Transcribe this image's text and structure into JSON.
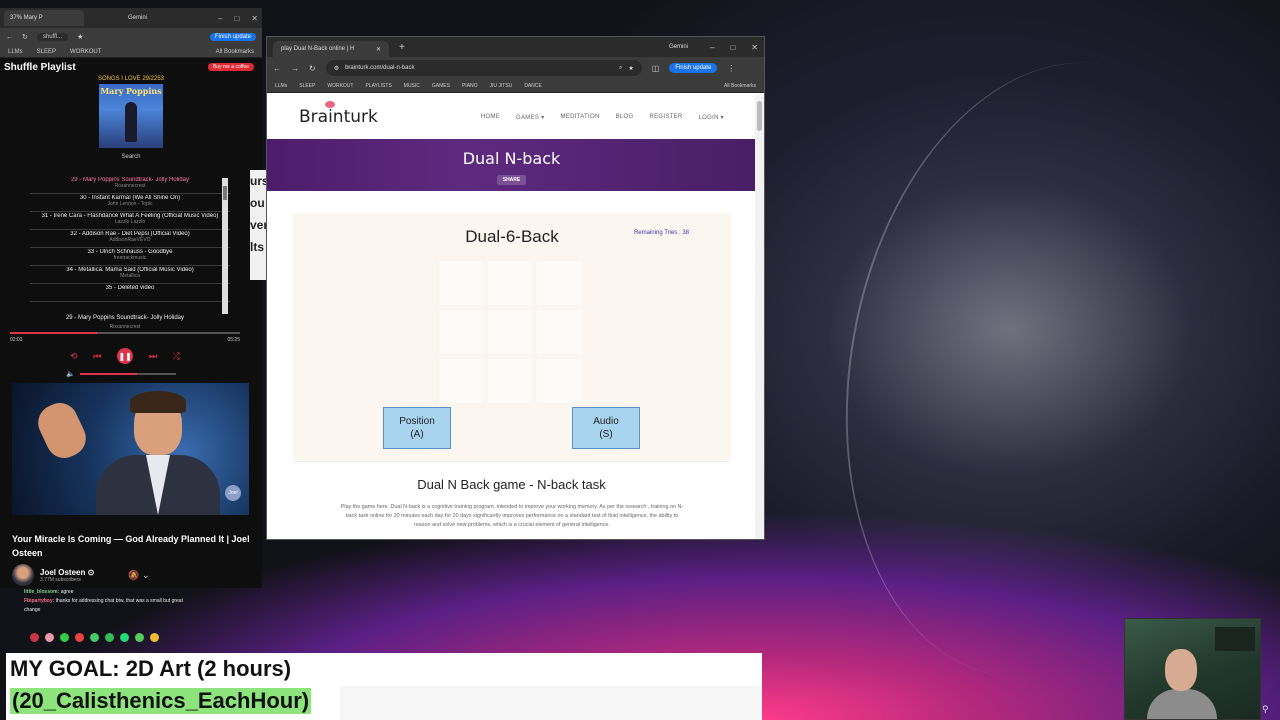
{
  "left_browser": {
    "tab_label": "37% Mary P",
    "tab2_label": "Gemini",
    "url_label": "shuffl...",
    "finish_update": "Finish update",
    "bookmarks": [
      "LLMs",
      "SLEEP",
      "WORKOUT",
      "All Bookmarks"
    ],
    "icons": [
      "back-icon",
      "forward-icon",
      "reload-icon",
      "star-icon",
      "menu-icon"
    ]
  },
  "shuffle": {
    "title": "Shuffle Playlist",
    "coffee_label": "Buy me a coffee",
    "songs_love": "SONGS I LOVE  29/2253",
    "poster_title": "Mary Poppins",
    "search_label": "Search",
    "playlist": [
      {
        "title": "29 - Mary Poppins Soundtrack- Jolly Holiday",
        "artist": "Roxannecrest",
        "active": true
      },
      {
        "title": "30 - Instant Karma! (We All Shine On)",
        "artist": "John Lennon - Topic",
        "active": false
      },
      {
        "title": "31 - Irene Cara - Flashdance What A Feeling (Official Music Video)",
        "artist": "Lazzlo Lazzlo",
        "active": false
      },
      {
        "title": "32 - Addison Rae - Diet Pepsi (Official Video)",
        "artist": "AddisonRaeVEVO",
        "active": false
      },
      {
        "title": "33 - Ulrich Schnauss - Goodbye",
        "artist": "freetrackmusic",
        "active": false
      },
      {
        "title": "34 - Metallica: Mama Said (Official Music Video)",
        "artist": "Metallica",
        "active": false
      },
      {
        "title": "35 - Deleted video",
        "artist": "",
        "active": false
      }
    ],
    "now_playing": "29 - Mary Poppins Soundtrack- Jolly Holiday",
    "now_artist": "Roxannecrest",
    "time_current": "02:03",
    "time_total": "05:25",
    "progress": 0.38
  },
  "video": {
    "title": "Your Miracle Is Coming — God Already Planned It | Joel Osteen",
    "channel": "Joel Osteen ⊙",
    "subscribers": "3.77M subscribers",
    "badge": "Joel"
  },
  "chat": [
    {
      "user": "little_blossom:",
      "text": "agree"
    },
    {
      "user": "Fbipartyboy:",
      "text": "thanks for addressing chat btw, that was a small but great change"
    }
  ],
  "cover_strip": [
    "urs",
    "ou",
    "ver",
    "lts"
  ],
  "main_browser": {
    "tab_label": "play Dual N-Back online | H",
    "gemini": "Gemini",
    "url": "brainturk.com/dual-n-back",
    "finish_update": "Finish update",
    "bookmarks": [
      "LLMs",
      "SLEEP",
      "WORKOUT",
      "PLAYLISTS",
      "MUSIC",
      "GAMES",
      "PIANO",
      "JIU JITSU",
      "DANCE",
      "All Bookmarks"
    ]
  },
  "site": {
    "logo": "Brainturk",
    "menu": [
      "HOME",
      "GAMES ▾",
      "MEDITATION",
      "BLOG",
      "REGISTER",
      "LOGIN ▾"
    ],
    "banner_title": "Dual N-back",
    "share_label": "SHARE",
    "game_title": "Dual-6-Back",
    "remaining_tries": "Remaining Tries : 38",
    "position_button": {
      "line1": "Position",
      "line2": "(A)"
    },
    "audio_button": {
      "line1": "Audio",
      "line2": "(S)"
    },
    "section_title": "Dual N Back game - N-back task",
    "description": "Play the game here. Dual N-back is a cognitive training program, intended to improve your working memory. As per the research , training on N-back task online for 20 minutes each day for 20 days significantly improves performance on a standard test of fluid intelligence, the ability to reason and solve new problems, which is a crucial element of general intelligence."
  },
  "goal": {
    "line1": "MY GOAL: 2D Art (2 hours)",
    "line2": "(20_Calisthenics_EachHour)"
  },
  "colors": {
    "brand_purple": "#4d1c6a",
    "button_blue": "#a8d4f0",
    "accent_red": "#e0324b",
    "goal_green": "#8de37c"
  }
}
